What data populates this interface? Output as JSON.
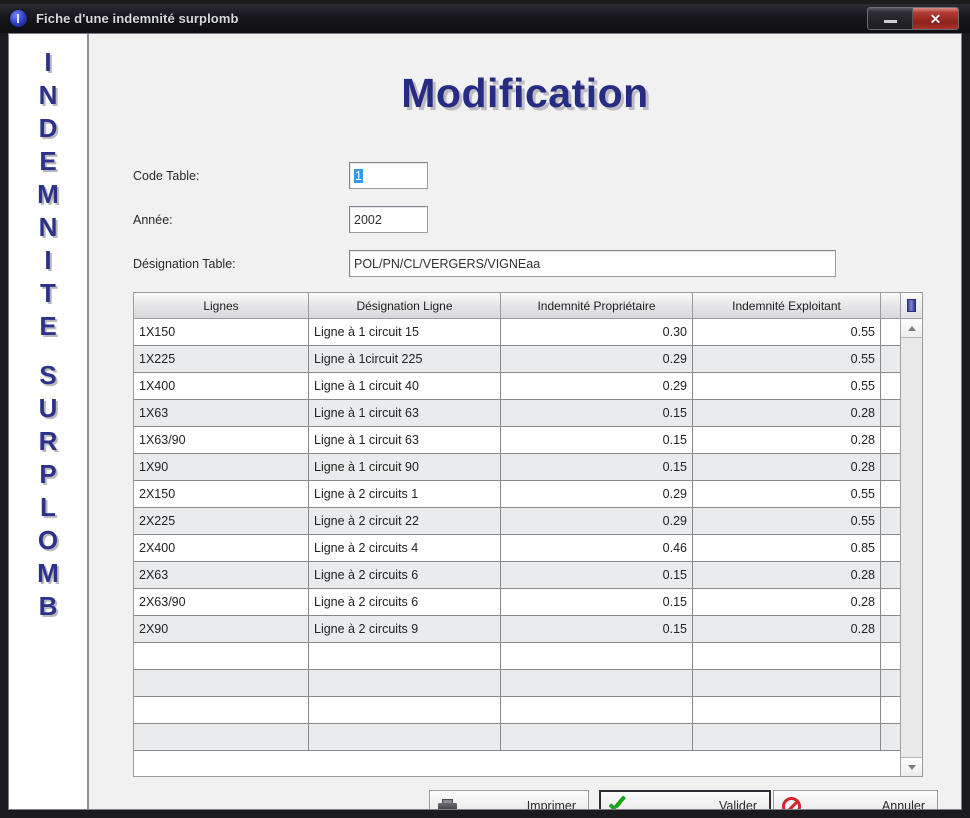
{
  "window": {
    "title": "Fiche d'une indemnité surplomb",
    "minimize_label": "",
    "close_label": "✕"
  },
  "banner": {
    "text": "INDEMNITE SURPLOMB",
    "letters_line1": [
      "I",
      "N",
      "D",
      "E",
      "M",
      "N",
      "I",
      "T",
      "E"
    ],
    "letters_line2": [
      "S",
      "U",
      "R",
      "P",
      "L",
      "O",
      "M",
      "B"
    ]
  },
  "heading": "Modification",
  "form": {
    "code_table": {
      "label": "Code Table:",
      "value": "1",
      "selected": true
    },
    "annee": {
      "label": "Année:",
      "value": "2002"
    },
    "designation_table": {
      "label": "Désignation Table:",
      "value": "POL/PN/CL/VERGERS/VIGNEaa"
    }
  },
  "grid": {
    "columns": [
      "Lignes",
      "Désignation Ligne",
      "Indemnité Propriétaire",
      "Indemnité Exploitant"
    ],
    "corner_icon": "grid-settings-icon",
    "rows": [
      {
        "ligne": "1X150",
        "designation": "Ligne à 1 circuit 15",
        "proprietaire": "0.30",
        "exploitant": "0.55"
      },
      {
        "ligne": "1X225",
        "designation": "Ligne à 1circuit 225",
        "proprietaire": "0.29",
        "exploitant": "0.55"
      },
      {
        "ligne": "1X400",
        "designation": "Ligne à 1 circuit 40",
        "proprietaire": "0.29",
        "exploitant": "0.55"
      },
      {
        "ligne": "1X63",
        "designation": "Ligne à 1 circuit 63",
        "proprietaire": "0.15",
        "exploitant": "0.28"
      },
      {
        "ligne": "1X63/90",
        "designation": "Ligne à 1 circuit 63",
        "proprietaire": "0.15",
        "exploitant": "0.28"
      },
      {
        "ligne": "1X90",
        "designation": "Ligne à 1 circuit 90",
        "proprietaire": "0.15",
        "exploitant": "0.28"
      },
      {
        "ligne": "2X150",
        "designation": "Ligne à 2 circuits 1",
        "proprietaire": "0.29",
        "exploitant": "0.55"
      },
      {
        "ligne": "2X225",
        "designation": "Ligne à 2 circuit 22",
        "proprietaire": "0.29",
        "exploitant": "0.55"
      },
      {
        "ligne": "2X400",
        "designation": "Ligne à 2 circuits 4",
        "proprietaire": "0.46",
        "exploitant": "0.85"
      },
      {
        "ligne": "2X63",
        "designation": "Ligne à 2 circuits 6",
        "proprietaire": "0.15",
        "exploitant": "0.28"
      },
      {
        "ligne": "2X63/90",
        "designation": "Ligne à 2 circuits 6",
        "proprietaire": "0.15",
        "exploitant": "0.28"
      },
      {
        "ligne": "2X90",
        "designation": "Ligne à 2 circuits 9",
        "proprietaire": "0.15",
        "exploitant": "0.28"
      },
      {
        "ligne": "",
        "designation": "",
        "proprietaire": "",
        "exploitant": ""
      },
      {
        "ligne": "",
        "designation": "",
        "proprietaire": "",
        "exploitant": ""
      },
      {
        "ligne": "",
        "designation": "",
        "proprietaire": "",
        "exploitant": ""
      },
      {
        "ligne": "",
        "designation": "",
        "proprietaire": "",
        "exploitant": ""
      }
    ]
  },
  "footer": {
    "imprimer": {
      "label": "Imprimer",
      "icon": "printer-icon"
    },
    "valider": {
      "label_prefix": "",
      "accesskey": "V",
      "label_rest": "alider",
      "icon": "green-check-icon",
      "default": true
    },
    "annuler": {
      "label_prefix": "",
      "accesskey": "A",
      "label_rest": "nnuler",
      "icon": "no-entry-icon"
    }
  },
  "colors": {
    "title_blue": "#262c82",
    "close_red": "#b23a32",
    "selection_blue": "#3399ee",
    "check_green": "#19a31b",
    "no_entry_red": "#d1262a"
  }
}
